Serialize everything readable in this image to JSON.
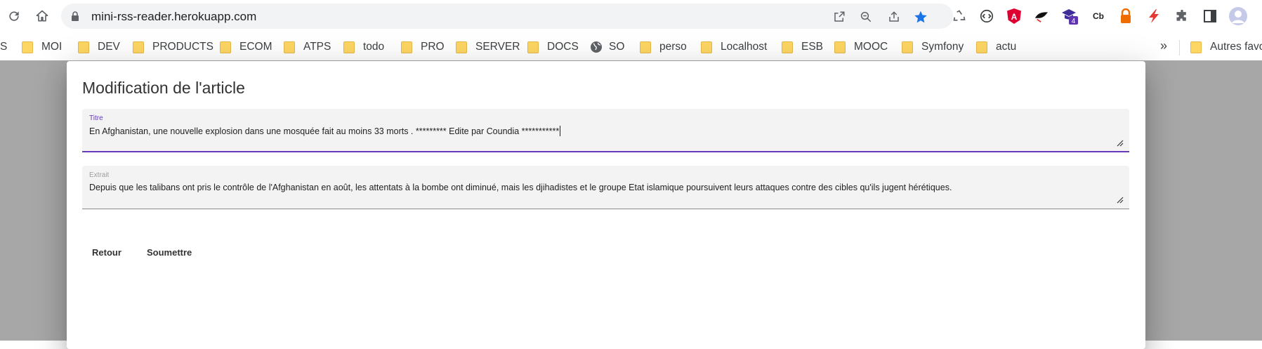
{
  "browser": {
    "url": "mini-rss-reader.herokuapp.com",
    "extensions": [
      {
        "name": "recycle-extension-icon"
      },
      {
        "name": "code-extension-icon"
      },
      {
        "name": "angular-extension-icon",
        "label": "A"
      },
      {
        "name": "bird-extension-icon"
      },
      {
        "name": "graduation-extension-icon",
        "badge": "4"
      },
      {
        "name": "coinbase-extension-icon",
        "label": "Cb"
      },
      {
        "name": "lock-orange-extension-icon"
      },
      {
        "name": "lightning-extension-icon"
      },
      {
        "name": "puzzle-extensions-icon"
      },
      {
        "name": "side-panel-icon"
      },
      {
        "name": "profile-avatar"
      }
    ],
    "bookmarks": [
      "S",
      "MOI",
      "DEV",
      "PRODUCTS",
      "ECOM",
      "ATPS",
      "todo",
      "PRO",
      "SERVER",
      "DOCS",
      "SO",
      "perso",
      "Localhost",
      "ESB",
      "MOOC",
      "Symfony",
      "actu"
    ],
    "bookmarks_more": "»",
    "other_bookmarks": "Autres favo"
  },
  "dialog": {
    "title": "Modification de l'article",
    "fields": {
      "titre": {
        "label": "Titre",
        "value": "En Afghanistan, une nouvelle explosion dans une mosquée fait au moins 33 morts .  ********* Edite par Coundia ***********"
      },
      "extrait": {
        "label": "Extrait",
        "value": "Depuis que les talibans ont pris le contrôle de l'Afghanistan en août, les attentats à la bombe ont diminué, mais les djihadistes et le groupe Etat islamique poursuivent leurs attaques contre des cibles qu'ils jugent hérétiques."
      }
    },
    "actions": {
      "back": "Retour",
      "submit": "Soumettre"
    }
  },
  "colors": {
    "accent": "#673ab7",
    "star": "#1a73e8",
    "backdrop": "#a7a7a7"
  }
}
